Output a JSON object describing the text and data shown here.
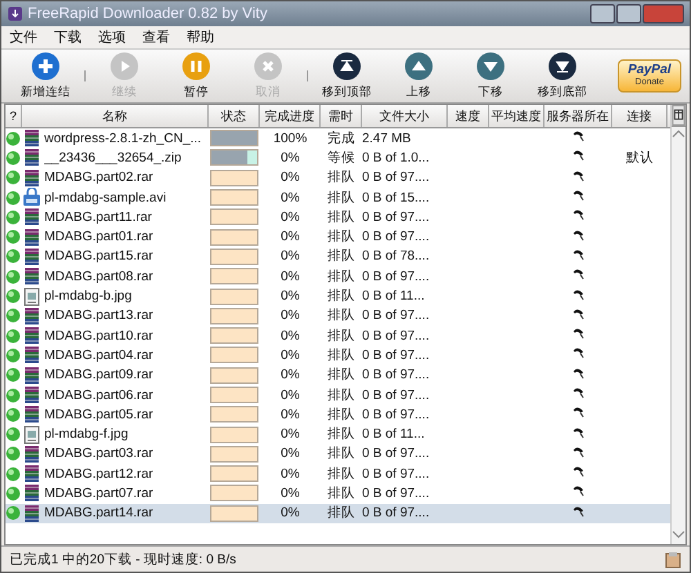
{
  "window": {
    "title": "FreeRapid Downloader 0.82 by Vity"
  },
  "menu": [
    "文件",
    "下载",
    "选项",
    "查看",
    "帮助"
  ],
  "toolbar": [
    {
      "kind": "add",
      "label": "新增连结",
      "disabled": false
    },
    {
      "kind": "separator"
    },
    {
      "kind": "resume",
      "label": "继续",
      "disabled": true
    },
    {
      "kind": "pause",
      "label": "暂停",
      "disabled": false
    },
    {
      "kind": "cancel",
      "label": "取消",
      "disabled": true
    },
    {
      "kind": "separator"
    },
    {
      "kind": "top",
      "label": "移到顶部",
      "disabled": false
    },
    {
      "kind": "up",
      "label": "上移",
      "disabled": false
    },
    {
      "kind": "down",
      "label": "下移",
      "disabled": false
    },
    {
      "kind": "bottom",
      "label": "移到底部",
      "disabled": false
    },
    {
      "kind": "donate",
      "label": "PayPal",
      "sublabel": "Donate",
      "disabled": false
    }
  ],
  "table": {
    "columns": [
      "?",
      "名称",
      "状态",
      "完成进度",
      "需时",
      "文件大小",
      "速度",
      "平均速度",
      "服务器所在",
      "连接"
    ],
    "rows": [
      {
        "kind": "rar",
        "name": "wordpress-2.8.1-zh_CN_...",
        "level": 1,
        "progress": "100%",
        "time": "完成",
        "size": "2.47 MB",
        "connection": "",
        "selected": false
      },
      {
        "kind": "rar",
        "name": "__23436___32654_.zip",
        "level": 0.78,
        "progress": "0%",
        "time": "等候",
        "size": "0 B of 1.0...",
        "connection": "默认",
        "selected": false
      },
      {
        "kind": "rar",
        "name": "MDABG.part02.rar",
        "level": 0,
        "progress": "0%",
        "time": "排队",
        "size": "0 B of 97....",
        "connection": "",
        "selected": false
      },
      {
        "kind": "video",
        "name": "pl-mdabg-sample.avi",
        "level": 0,
        "progress": "0%",
        "time": "排队",
        "size": "0 B of 15....",
        "connection": "",
        "selected": false
      },
      {
        "kind": "rar",
        "name": "MDABG.part11.rar",
        "level": 0,
        "progress": "0%",
        "time": "排队",
        "size": "0 B of 97....",
        "connection": "",
        "selected": false
      },
      {
        "kind": "rar",
        "name": "MDABG.part01.rar",
        "level": 0,
        "progress": "0%",
        "time": "排队",
        "size": "0 B of 97....",
        "connection": "",
        "selected": false
      },
      {
        "kind": "rar",
        "name": "MDABG.part15.rar",
        "level": 0,
        "progress": "0%",
        "time": "排队",
        "size": "0 B of 78....",
        "connection": "",
        "selected": false
      },
      {
        "kind": "rar",
        "name": "MDABG.part08.rar",
        "level": 0,
        "progress": "0%",
        "time": "排队",
        "size": "0 B of 97....",
        "connection": "",
        "selected": false
      },
      {
        "kind": "image",
        "name": "pl-mdabg-b.jpg",
        "level": 0,
        "progress": "0%",
        "time": "排队",
        "size": "0 B of 11...",
        "connection": "",
        "selected": false
      },
      {
        "kind": "rar",
        "name": "MDABG.part13.rar",
        "level": 0,
        "progress": "0%",
        "time": "排队",
        "size": "0 B of 97....",
        "connection": "",
        "selected": false
      },
      {
        "kind": "rar",
        "name": "MDABG.part10.rar",
        "level": 0,
        "progress": "0%",
        "time": "排队",
        "size": "0 B of 97....",
        "connection": "",
        "selected": false
      },
      {
        "kind": "rar",
        "name": "MDABG.part04.rar",
        "level": 0,
        "progress": "0%",
        "time": "排队",
        "size": "0 B of 97....",
        "connection": "",
        "selected": false
      },
      {
        "kind": "rar",
        "name": "MDABG.part09.rar",
        "level": 0,
        "progress": "0%",
        "time": "排队",
        "size": "0 B of 97....",
        "connection": "",
        "selected": false
      },
      {
        "kind": "rar",
        "name": "MDABG.part06.rar",
        "level": 0,
        "progress": "0%",
        "time": "排队",
        "size": "0 B of 97....",
        "connection": "",
        "selected": false
      },
      {
        "kind": "rar",
        "name": "MDABG.part05.rar",
        "level": 0,
        "progress": "0%",
        "time": "排队",
        "size": "0 B of 97....",
        "connection": "",
        "selected": false
      },
      {
        "kind": "image",
        "name": "pl-mdabg-f.jpg",
        "level": 0,
        "progress": "0%",
        "time": "排队",
        "size": "0 B of 11...",
        "connection": "",
        "selected": false
      },
      {
        "kind": "rar",
        "name": "MDABG.part03.rar",
        "level": 0,
        "progress": "0%",
        "time": "排队",
        "size": "0 B of 97....",
        "connection": "",
        "selected": false
      },
      {
        "kind": "rar",
        "name": "MDABG.part12.rar",
        "level": 0,
        "progress": "0%",
        "time": "排队",
        "size": "0 B of 97....",
        "connection": "",
        "selected": false
      },
      {
        "kind": "rar",
        "name": "MDABG.part07.rar",
        "level": 0,
        "progress": "0%",
        "time": "排队",
        "size": "0 B of 97....",
        "connection": "",
        "selected": false
      },
      {
        "kind": "rar",
        "name": "MDABG.part14.rar",
        "level": 0,
        "progress": "0%",
        "time": "排队",
        "size": "0 B of 97....",
        "connection": "",
        "selected": true
      }
    ]
  },
  "status_bar": "已完成1 中的20下载 - 现时速度: 0 B/s"
}
